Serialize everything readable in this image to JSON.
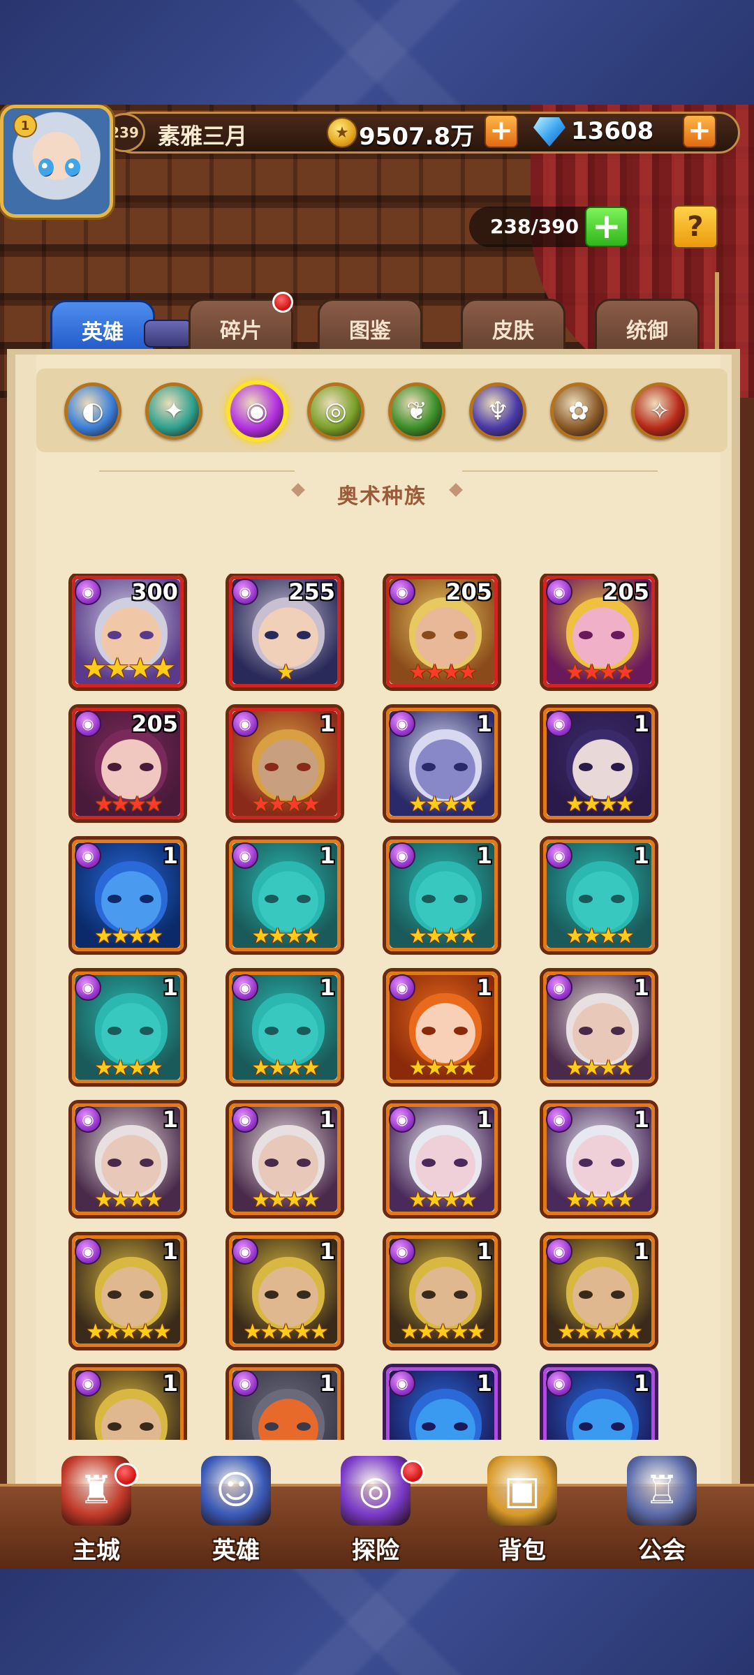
{
  "player": {
    "name": "素雅三月",
    "level": "239",
    "vip": "1",
    "gold": "9507.8万",
    "gems": "13608"
  },
  "roster": {
    "capacity": "238/390"
  },
  "tabs": [
    {
      "label": "英雄",
      "active": true,
      "badge": false
    },
    {
      "label": "碎片",
      "active": false,
      "badge": true
    },
    {
      "label": "图鉴",
      "active": false,
      "badge": false
    },
    {
      "label": "皮肤",
      "active": false,
      "badge": false
    },
    {
      "label": "统御",
      "active": false,
      "badge": false
    }
  ],
  "race_filters": [
    {
      "icon": "all-races-icon",
      "color": "#3a7fd8",
      "active": false
    },
    {
      "icon": "race-teal-icon",
      "color": "#2fa18f",
      "active": false
    },
    {
      "icon": "arcane-race-icon",
      "color": "#b12fe0",
      "active": true
    },
    {
      "icon": "race-green-icon",
      "color": "#7aa12a",
      "active": false
    },
    {
      "icon": "race-forest-icon",
      "color": "#3a8f2a",
      "active": false
    },
    {
      "icon": "race-purple-icon",
      "color": "#4a3aa8",
      "active": false
    },
    {
      "icon": "race-brown-icon",
      "color": "#8a5a2a",
      "active": false
    },
    {
      "icon": "race-red-icon",
      "color": "#b82a1a",
      "active": false
    }
  ],
  "section": {
    "title": "奥术种族"
  },
  "heroes": [
    {
      "level": "300",
      "stars": "★★★★",
      "star_color": "gold",
      "quality": "red",
      "palette": [
        "#5a3a8a",
        "#cfcfe0",
        "#f0c8a8"
      ]
    },
    {
      "level": "255",
      "stars": "★",
      "star_color": "gold",
      "quality": "red",
      "palette": [
        "#2a2a5a",
        "#c8c0d0",
        "#f0d0b8"
      ]
    },
    {
      "level": "205",
      "stars": "★★★★",
      "star_color": "red",
      "quality": "red",
      "palette": [
        "#8a4a1a",
        "#e8c860",
        "#e8b898"
      ]
    },
    {
      "level": "205",
      "stars": "★★★★",
      "star_color": "red",
      "quality": "red",
      "palette": [
        "#6a1a5a",
        "#f0c040",
        "#f0b0c8"
      ]
    },
    {
      "level": "205",
      "stars": "★★★★",
      "star_color": "red",
      "quality": "red",
      "palette": [
        "#4a1a3a",
        "#7a2a5a",
        "#f0c8c0"
      ]
    },
    {
      "level": "1",
      "stars": "★★★★",
      "star_color": "red",
      "quality": "red",
      "palette": [
        "#8a2a1a",
        "#d8a040",
        "#c8a080"
      ]
    },
    {
      "level": "1",
      "stars": "★★★★",
      "star_color": "gold",
      "quality": "orange",
      "palette": [
        "#2a2a6a",
        "#d8d8f0",
        "#8888c8"
      ]
    },
    {
      "level": "1",
      "stars": "★★★★",
      "star_color": "gold",
      "quality": "orange",
      "palette": [
        "#2a1a4a",
        "#3a2a6a",
        "#e8d8d8"
      ]
    },
    {
      "level": "1",
      "stars": "★★★★",
      "star_color": "gold",
      "quality": "orange",
      "palette": [
        "#0a2a6a",
        "#2a6ad8",
        "#4a9af0"
      ]
    },
    {
      "level": "1",
      "stars": "★★★★",
      "star_color": "gold",
      "quality": "orange",
      "palette": [
        "#1a5a5a",
        "#2ab8b0",
        "#38c8c0"
      ]
    },
    {
      "level": "1",
      "stars": "★★★★",
      "star_color": "gold",
      "quality": "orange",
      "palette": [
        "#1a5a5a",
        "#2ab8b0",
        "#38c8c0"
      ]
    },
    {
      "level": "1",
      "stars": "★★★★",
      "star_color": "gold",
      "quality": "orange",
      "palette": [
        "#1a5a5a",
        "#2ab8b0",
        "#38c8c0"
      ]
    },
    {
      "level": "1",
      "stars": "★★★★",
      "star_color": "gold",
      "quality": "orange",
      "palette": [
        "#1a5a5a",
        "#2ab8b0",
        "#38c8c0"
      ]
    },
    {
      "level": "1",
      "stars": "★★★★",
      "star_color": "gold",
      "quality": "orange",
      "palette": [
        "#1a5a5a",
        "#2ab8b0",
        "#38c8c0"
      ]
    },
    {
      "level": "1",
      "stars": "★★★★",
      "star_color": "gold",
      "quality": "orange",
      "palette": [
        "#8a2a0a",
        "#e86a1a",
        "#f8d0b8"
      ]
    },
    {
      "level": "1",
      "stars": "★★★★",
      "star_color": "gold",
      "quality": "orange",
      "palette": [
        "#4a2a4a",
        "#e8e0e0",
        "#e8c8b8"
      ]
    },
    {
      "level": "1",
      "stars": "★★★★",
      "star_color": "gold",
      "quality": "orange",
      "palette": [
        "#4a2a4a",
        "#e8e0e0",
        "#e8c8b8"
      ]
    },
    {
      "level": "1",
      "stars": "★★★★",
      "star_color": "gold",
      "quality": "orange",
      "palette": [
        "#4a2a4a",
        "#e8e0e0",
        "#e8c8b8"
      ]
    },
    {
      "level": "1",
      "stars": "★★★★",
      "star_color": "gold",
      "quality": "orange",
      "palette": [
        "#4a2a5a",
        "#e8e8f0",
        "#f0d0d8"
      ]
    },
    {
      "level": "1",
      "stars": "★★★★",
      "star_color": "gold",
      "quality": "orange",
      "palette": [
        "#4a2a5a",
        "#e8e8f0",
        "#f0d0d8"
      ]
    },
    {
      "level": "1",
      "stars": "★★★★★",
      "star_color": "gold",
      "quality": "orange",
      "palette": [
        "#3a2a1a",
        "#d8b840",
        "#e0b890"
      ]
    },
    {
      "level": "1",
      "stars": "★★★★★",
      "star_color": "gold",
      "quality": "orange",
      "palette": [
        "#3a2a1a",
        "#d8b840",
        "#e0b890"
      ]
    },
    {
      "level": "1",
      "stars": "★★★★★",
      "star_color": "gold",
      "quality": "orange",
      "palette": [
        "#3a2a1a",
        "#d8b840",
        "#e0b890"
      ]
    },
    {
      "level": "1",
      "stars": "★★★★★",
      "star_color": "gold",
      "quality": "orange",
      "palette": [
        "#3a2a1a",
        "#d8b840",
        "#e0b890"
      ]
    },
    {
      "level": "1",
      "stars": "",
      "star_color": "gold",
      "quality": "orange",
      "palette": [
        "#3a2a1a",
        "#d8b840",
        "#e0b890"
      ]
    },
    {
      "level": "1",
      "stars": "",
      "star_color": "gold",
      "quality": "orange",
      "palette": [
        "#3a3a4a",
        "#6a6a7a",
        "#e86a2a"
      ]
    },
    {
      "level": "1",
      "stars": "",
      "star_color": "gold",
      "quality": "purple",
      "palette": [
        "#1a1a5a",
        "#2a6ad8",
        "#3a9af0"
      ]
    },
    {
      "level": "1",
      "stars": "",
      "star_color": "gold",
      "quality": "purple",
      "palette": [
        "#1a1a5a",
        "#2a6ad8",
        "#3a9af0"
      ]
    }
  ],
  "bottom_nav": [
    {
      "label": "主城",
      "icon": "castle-icon",
      "badge": true,
      "color": "#c23a2a"
    },
    {
      "label": "英雄",
      "icon": "hero-icon",
      "badge": false,
      "color": "#3a5ab8"
    },
    {
      "label": "探险",
      "icon": "portal-icon",
      "badge": true,
      "color": "#7a3ac8"
    },
    {
      "label": "背包",
      "icon": "backpack-icon",
      "badge": false,
      "color": "#d89a2a"
    },
    {
      "label": "公会",
      "icon": "guild-icon",
      "badge": false,
      "color": "#5a6aa8"
    }
  ]
}
